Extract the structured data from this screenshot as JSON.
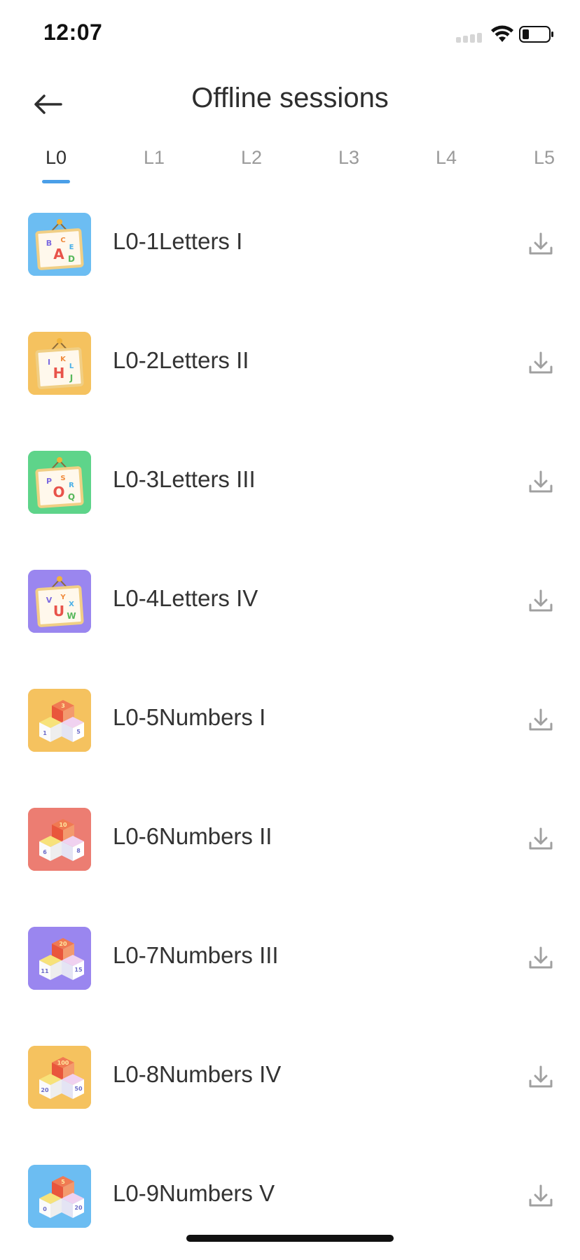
{
  "status_bar": {
    "time": "12:07"
  },
  "header": {
    "title": "Offline sessions"
  },
  "tabs": [
    {
      "label": "L0",
      "active": true
    },
    {
      "label": "L1",
      "active": false
    },
    {
      "label": "L2",
      "active": false
    },
    {
      "label": "L3",
      "active": false
    },
    {
      "label": "L4",
      "active": false
    },
    {
      "label": "L5",
      "active": false
    }
  ],
  "sessions": [
    {
      "title": "L0-1Letters I",
      "icon": "alphabet-board-icon",
      "icon_color": "#6cbdf2",
      "letters": [
        "B",
        "C",
        "A",
        "E",
        "D"
      ]
    },
    {
      "title": "L0-2Letters II",
      "icon": "alphabet-board-icon",
      "icon_color": "#f5c25f",
      "letters": [
        "I",
        "K",
        "H",
        "L",
        "J"
      ]
    },
    {
      "title": "L0-3Letters III",
      "icon": "alphabet-board-icon",
      "icon_color": "#5ed48a",
      "letters": [
        "P",
        "S",
        "O",
        "R",
        "Q"
      ]
    },
    {
      "title": "L0-4Letters IV",
      "icon": "alphabet-board-icon",
      "icon_color": "#9a86ef",
      "letters": [
        "V",
        "Y",
        "U",
        "X",
        "W"
      ]
    },
    {
      "title": "L0-5Numbers I",
      "icon": "number-blocks-icon",
      "icon_color": "#f5c25f",
      "numbers": [
        "3",
        "1",
        "5"
      ]
    },
    {
      "title": "L0-6Numbers II",
      "icon": "number-blocks-icon",
      "icon_color": "#ec7d72",
      "numbers": [
        "10",
        "6",
        "8"
      ]
    },
    {
      "title": "L0-7Numbers III",
      "icon": "number-blocks-icon",
      "icon_color": "#9a86ef",
      "numbers": [
        "20",
        "11",
        "15"
      ]
    },
    {
      "title": "L0-8Numbers IV",
      "icon": "number-blocks-icon",
      "icon_color": "#f5c25f",
      "numbers": [
        "100",
        "20",
        "50"
      ]
    },
    {
      "title": "L0-9Numbers V",
      "icon": "number-blocks-icon",
      "icon_color": "#6cbdf2",
      "numbers": [
        "5",
        "0",
        "20"
      ]
    }
  ],
  "colors": {
    "accent": "#4a9fe8",
    "text": "#333333",
    "muted": "#9a9a9a",
    "icon_gray": "#a0a0a0"
  }
}
